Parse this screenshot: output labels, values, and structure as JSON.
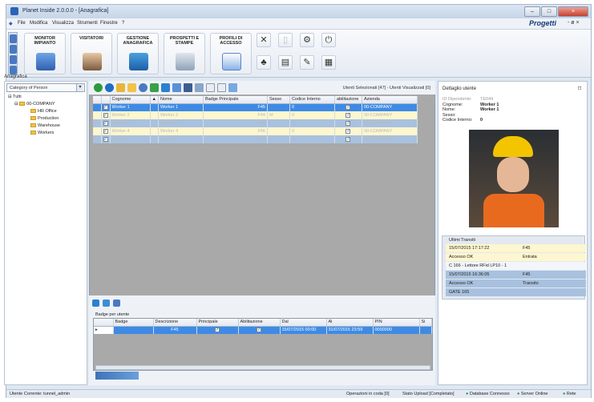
{
  "title": "Planet Inside 2.0.0.0 - [Anagrafica]",
  "menu": [
    "File",
    "Modifica",
    "Visualizza",
    "Strumenti",
    "Finestre",
    "?"
  ],
  "brand": "Progetti",
  "mdi_controls": "- ø ×",
  "ribbon": {
    "buttons": [
      {
        "label": "MONITOR IMPIANTO"
      },
      {
        "label": "VISITATORI"
      },
      {
        "label": "GESTIONE ANAGRAFICA"
      },
      {
        "label": "PROSPETTI E STAMPE"
      },
      {
        "label": "PROFILI DI ACCESSO"
      }
    ]
  },
  "left": {
    "header": "Anagrafica",
    "combo": "Category of Person",
    "tree": [
      "Tutti",
      "00-COMPANY",
      "HR Office",
      "Production",
      "Warehouse",
      "Workers"
    ]
  },
  "center": {
    "selection_text": "Utenti Selezionati [47] - Utenti Visualizzati [0]",
    "columns": [
      "Cognome",
      "Nome",
      "Badge Principale",
      "Sesso",
      "Codice Interno",
      "abilitazione",
      "Azienda"
    ],
    "sort_marker": "▲",
    "rows": [
      {
        "cognome": "Worker 1",
        "nome": "Worker 1",
        "badge": "F45",
        "sesso": "",
        "codice": "0",
        "azienda": "00-COMPANY",
        "style": "r-sel"
      },
      {
        "cognome": "Worker 2",
        "nome": "Worker 2",
        "badge": "F44",
        "sesso": "M",
        "codice": "0",
        "azienda": "00-COMPANY",
        "style": "r-y"
      },
      {
        "cognome": "Worker 3",
        "nome": "Worker 3",
        "badge": "F55",
        "sesso": "",
        "codice": "0",
        "azienda": "00-COMPANY",
        "style": "r-b"
      },
      {
        "cognome": "Worker 4",
        "nome": "Worker 4",
        "badge": "F56",
        "sesso": "",
        "codice": "0",
        "azienda": "00-COMPANY",
        "style": "r-y"
      },
      {
        "cognome": "Worker 5",
        "nome": "Worker 5",
        "badge": "F57",
        "sesso": "",
        "codice": "0",
        "azienda": "00-COMPANY",
        "style": "r-b"
      }
    ],
    "badge_title": "Badge per utente",
    "badge_columns": [
      "Badge",
      "Descrizione",
      "Principale",
      "Abilitazione",
      "Dal",
      "Al",
      "PIN",
      "Si"
    ],
    "badge_row": {
      "descr": "F45",
      "dal": "15/07/2015 00:00",
      "al": "31/07/2015 23:59",
      "pin": "0000000"
    }
  },
  "right": {
    "header": "Dettaglio utente",
    "fields": [
      {
        "label": "ID Dipendente:",
        "value": "TE044"
      },
      {
        "label": "Cognome:",
        "value": "Worker 1"
      },
      {
        "label": "Nome:",
        "value": "Worker 1"
      },
      {
        "label": "Sesso:",
        "value": ""
      },
      {
        "label": "Codice Interno:",
        "value": "0"
      }
    ],
    "transits_title": "Ultimi Transiti",
    "transits": [
      {
        "a": "15/07/2015 17:17:22",
        "b": "F45",
        "style": "y"
      },
      {
        "a": "Accesso OK",
        "b": "Entrata",
        "style": "y"
      },
      {
        "a": "C 166 - Lettore RFid LP10 - 1",
        "b": "",
        "style": "w"
      },
      {
        "a": "15/07/2015 16:36:05",
        "b": "F45",
        "style": "b"
      },
      {
        "a": "Accesso OK",
        "b": "Transito",
        "style": "b"
      },
      {
        "a": "GATE 165",
        "b": "",
        "style": "b"
      }
    ]
  },
  "status": {
    "user": "Utente Corrente: tunnel_admin",
    "queue": "Operazioni in coda [0]",
    "upload": "Stato Upload [Completato]",
    "db": "Database Connesso",
    "server": "Server Online",
    "net": "Rete"
  }
}
